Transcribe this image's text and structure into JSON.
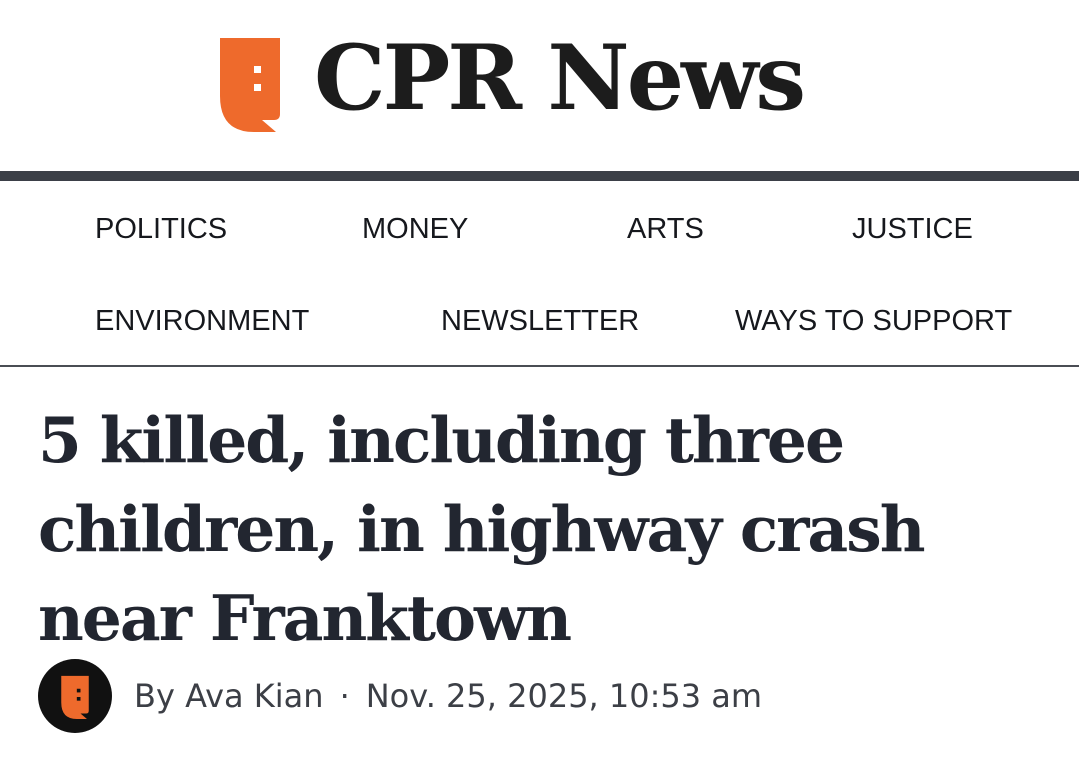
{
  "brand": {
    "name": "CPR News",
    "logo_icon": "cpr-logo-icon",
    "accent_color": "#ee6a2c"
  },
  "nav": {
    "row1": [
      "POLITICS",
      "MONEY",
      "ARTS",
      "JUSTICE"
    ],
    "row2": [
      "ENVIRONMENT",
      "NEWSLETTER",
      "WAYS TO SUPPORT"
    ]
  },
  "article": {
    "headline": "5 killed, including three children, in highway crash near Franktown",
    "byline": "By Ava Kian",
    "separator": "·",
    "date": "Nov. 25, 2025, 10:53 am"
  }
}
